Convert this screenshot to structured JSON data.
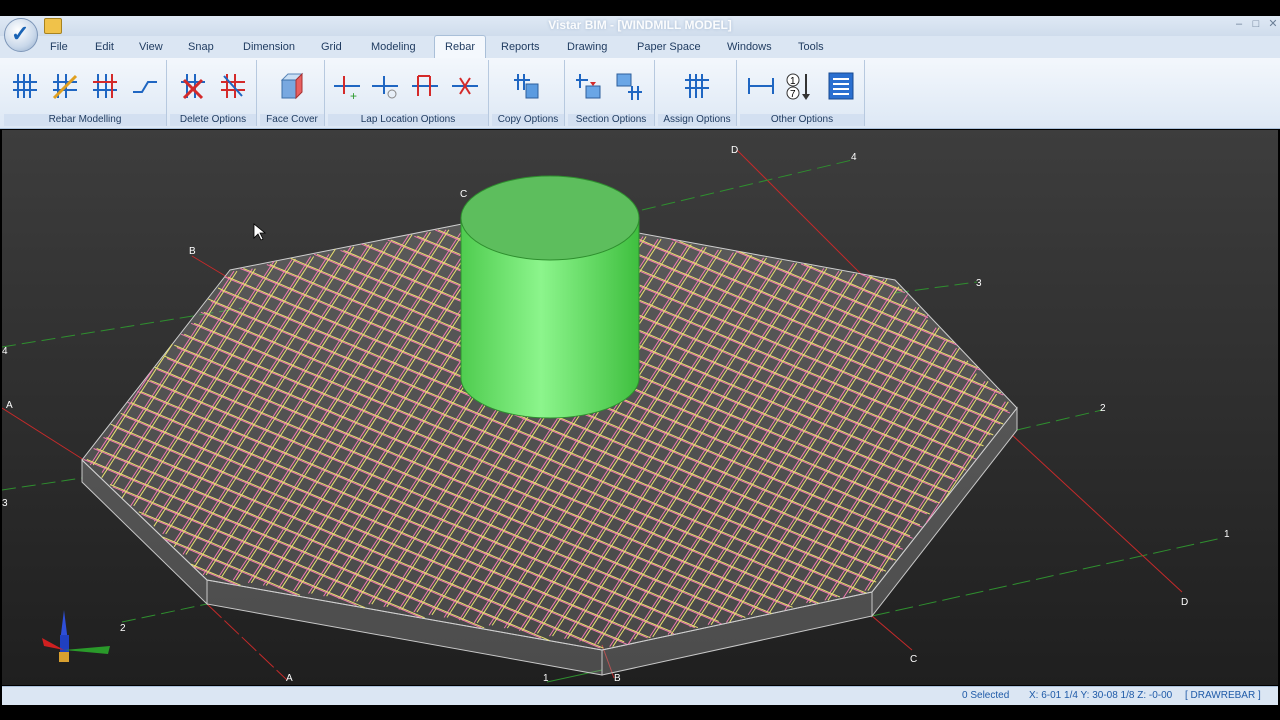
{
  "window": {
    "title": "Vistar BIM - [WINDMILL MODEL]"
  },
  "menu": {
    "items": [
      "File",
      "Edit",
      "View",
      "Snap",
      "Dimension",
      "Grid",
      "Modeling",
      "Rebar",
      "Reports",
      "Drawing",
      "Paper Space",
      "Windows",
      "Tools"
    ],
    "active": "Rebar"
  },
  "ribbon": {
    "groups": [
      {
        "label": "Rebar Modelling",
        "icons": [
          "rebar-layout-icon",
          "rebar-layout-diagonal-icon",
          "rebar-layout-red-icon",
          "rebar-bend-icon"
        ]
      },
      {
        "label": "Delete Options",
        "icons": [
          "delete-rebar-icon",
          "delete-rebar-set-icon"
        ]
      },
      {
        "label": "Face Cover",
        "icons": [
          "face-cover-icon"
        ]
      },
      {
        "label": "Lap Location Options",
        "icons": [
          "add-lap-icon",
          "move-lap-icon",
          "lap-location-icon",
          "remove-lap-icon"
        ]
      },
      {
        "label": "Copy Options",
        "icons": [
          "copy-rebar-icon"
        ]
      },
      {
        "label": "Section Options",
        "icons": [
          "section-rebar-icon",
          "section-copy-icon"
        ]
      },
      {
        "label": "Assign Options",
        "icons": [
          "assign-rebar-icon"
        ]
      },
      {
        "label": "Other Options",
        "icons": [
          "dimension-icon",
          "sort-numbers-icon",
          "list-icon"
        ]
      }
    ]
  },
  "viewport": {
    "grid_labels": {
      "letters": [
        "A",
        "B",
        "C",
        "D",
        "A",
        "B",
        "C",
        "D"
      ],
      "numbers": [
        "1",
        "2",
        "3",
        "4",
        "1",
        "2",
        "3",
        "4"
      ]
    },
    "colors": {
      "pedestal": "#6ee86e",
      "rebar_top": "#f07ab0",
      "rebar_bottom": "#e8e070",
      "grid_axis_red": "#c42a2a",
      "grid_axis_green": "#2f8f2f"
    }
  },
  "status": {
    "selected": "0 Selected",
    "coords": "X: 6-01 1/4  Y: 30-08 1/8  Z: -0-00",
    "command": "[ DRAWREBAR ]"
  }
}
